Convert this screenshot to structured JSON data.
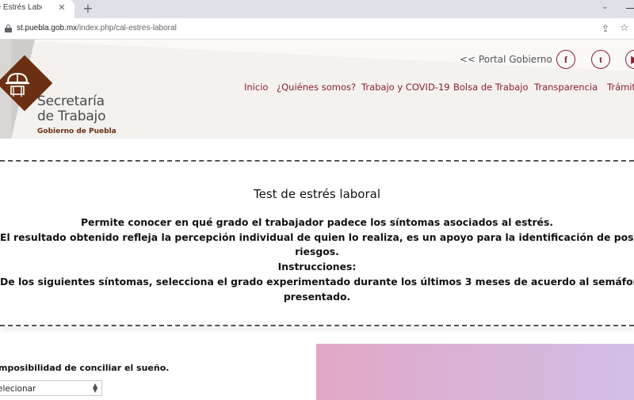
{
  "browser": {
    "tab_title": "de Estrés Laboral",
    "close_glyph": "✕",
    "new_tab_glyph": "+",
    "chevron_glyph": "⌄",
    "url_host": "st.puebla.gob.mx",
    "url_path": "/index.php/cal-estres-laboral",
    "icons": [
      "lock-icon",
      "share-icon",
      "star-icon",
      "close-icon",
      "new-tab-icon",
      "chevron-down-icon"
    ]
  },
  "header": {
    "brand_line1": "Secretaría",
    "brand_line2": "de Trabajo",
    "brand_line3": "Gobierno de Puebla",
    "portal_link": "<< Portal Gobierno",
    "social": {
      "facebook": "f",
      "twitter": "t",
      "youtube": "▶"
    },
    "nav": [
      "Inicio",
      "¿Quiénes somos?",
      "Trabajo y COVID-19",
      "Bolsa de Trabajo",
      "Transparencia",
      "Trámit"
    ],
    "colors": {
      "brand": "#6b2f12",
      "nav": "#8b1e2d",
      "header_bg": "#f4f2ef"
    }
  },
  "main": {
    "title": "Test de estrés laboral",
    "paragraphs": [
      "Permite conocer en qué grado el trabajador padece los síntomas asociados al estrés.",
      "El resultado obtenido refleja la percepción individual de quien lo realiza, es un apoyo para la identificación de posibles",
      "riesgos.",
      "Instrucciones:",
      "De los siguientes síntomas, selecciona el grado experimentado durante los últimos 3 meses de acuerdo al semáforo",
      "presentado."
    ]
  },
  "form": {
    "question": "mposibilidad de conciliar el sueño.",
    "select_value": "elecionar"
  }
}
